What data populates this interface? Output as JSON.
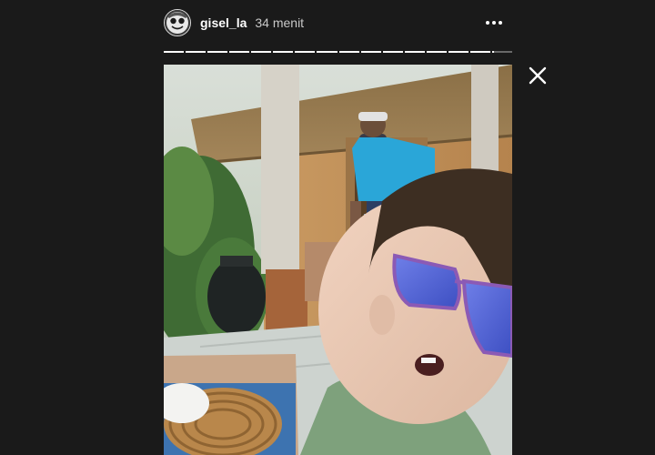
{
  "story": {
    "username": "gisel_la",
    "timestamp": "34 menit",
    "progress": {
      "segment_count": 16,
      "viewed_segments": 15,
      "current_segment_fraction": 0.1
    }
  },
  "icons": {
    "more": "more-options-icon",
    "close": "close-icon",
    "avatar": "profile-avatar"
  },
  "colors": {
    "background": "#1a1a1a",
    "text_primary": "#ffffff",
    "text_secondary": "#c8c8c8"
  }
}
